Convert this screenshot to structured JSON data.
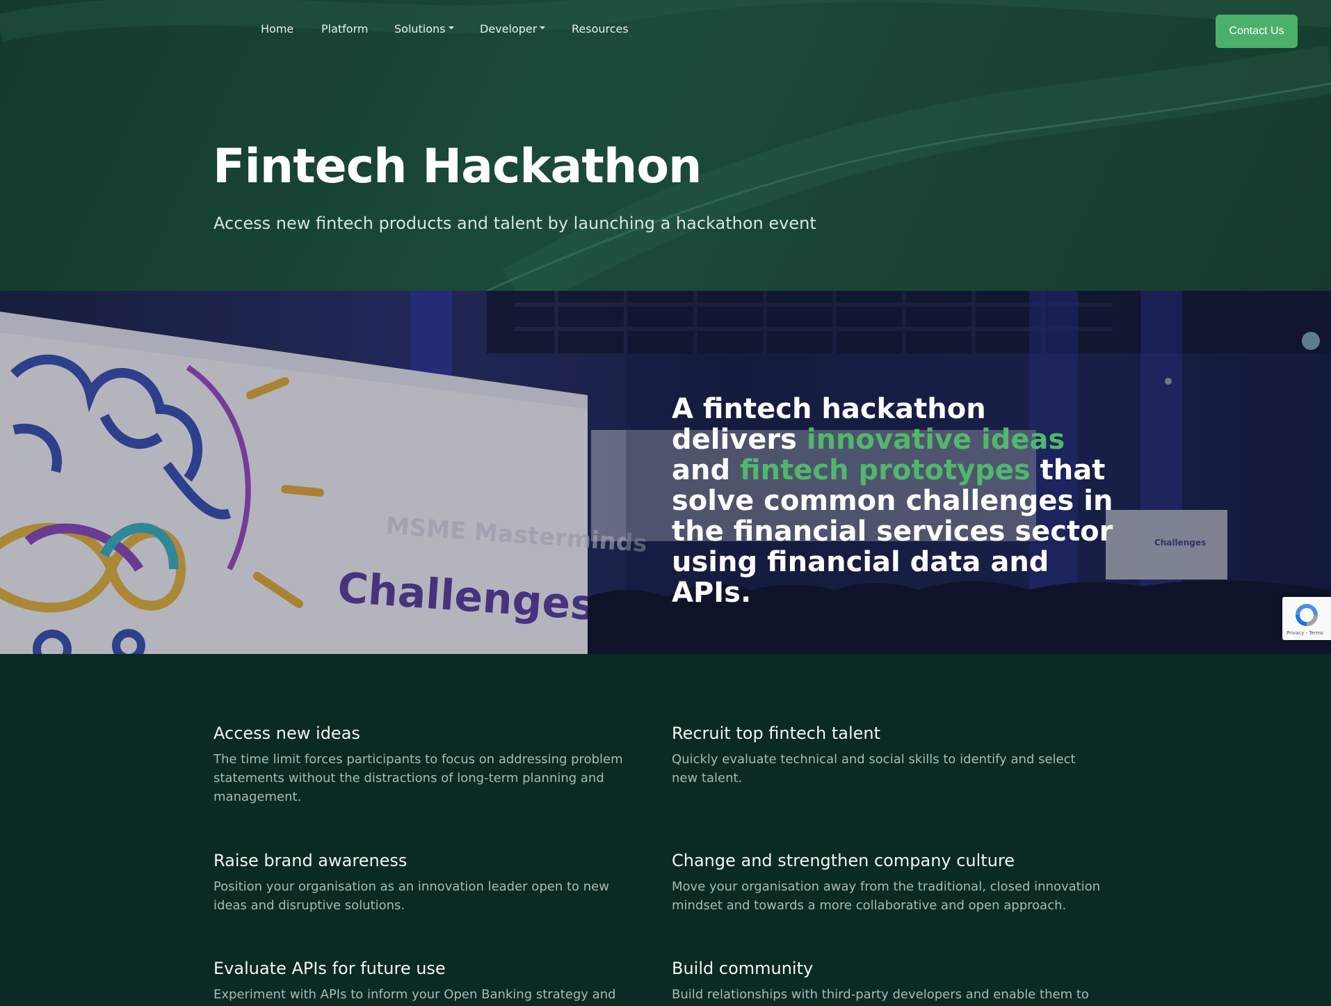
{
  "nav": {
    "items": [
      {
        "label": "Home"
      },
      {
        "label": "Platform"
      },
      {
        "label": "Solutions"
      },
      {
        "label": "Developer"
      },
      {
        "label": "Resources"
      }
    ],
    "contact_label": "Contact Us"
  },
  "hero": {
    "title": "Fintech Hackathon",
    "subtitle": "Access new fintech products and talent by launching a hackathon event"
  },
  "banner": {
    "quote_part1": "A fintech hackathon delivers ",
    "quote_hl1": "innovative ideas",
    "quote_part2": " and ",
    "quote_hl2": "fintech prototypes",
    "quote_part3": " that solve common challenges in the financial services sector using financial data and APIs.",
    "screen_text": "Challenges",
    "screen_text_small": "MSME Masterminds",
    "screen_text_right": "Challenges"
  },
  "recaptcha": {
    "text": "Privacy - Terms"
  },
  "features": [
    {
      "title": "Access new ideas",
      "body": "The time limit forces participants to focus on addressing problem statements without the distractions of long-term planning and management."
    },
    {
      "title": "Recruit top fintech talent",
      "body": "Quickly evaluate technical and social skills to identify and select new talent."
    },
    {
      "title": "Raise brand awareness",
      "body": "Position your organisation as an innovation leader open to new ideas and disruptive solutions."
    },
    {
      "title": "Change and strengthen company culture",
      "body": "Move your organisation away from the traditional, closed innovation mindset and towards a more collaborative and open approach."
    },
    {
      "title": "Evaluate APIs for future use",
      "body": "Experiment with APIs to inform your Open Banking strategy and help"
    },
    {
      "title": "Build community",
      "body": "Build relationships with third-party developers and enable them to"
    }
  ],
  "colors": {
    "accent": "#4caf6a",
    "highlight": "#4fb86b",
    "hero_bg": "#1b4a3a",
    "page_bg": "#0b2a22"
  }
}
